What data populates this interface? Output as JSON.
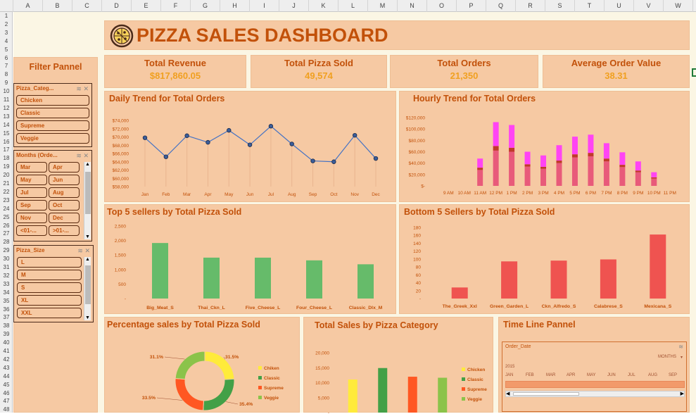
{
  "spreadsheet": {
    "columns": [
      "A",
      "B",
      "C",
      "D",
      "E",
      "F",
      "G",
      "H",
      "I",
      "J",
      "K",
      "L",
      "M",
      "N",
      "O",
      "P",
      "Q",
      "R",
      "S",
      "T",
      "U",
      "V",
      "W"
    ],
    "rows": [
      "1",
      "2",
      "3",
      "4",
      "5",
      "6",
      "7",
      "8",
      "9",
      "10",
      "11",
      "12",
      "13",
      "14",
      "15",
      "16",
      "17",
      "18",
      "19",
      "20",
      "21",
      "22",
      "23",
      "24",
      "25",
      "26",
      "27",
      "28",
      "29",
      "30",
      "31",
      "32",
      "33",
      "34",
      "35",
      "36",
      "37",
      "38",
      "39",
      "40",
      "41",
      "42",
      "43",
      "44",
      "45",
      "46",
      "47",
      "48"
    ]
  },
  "dashboard": {
    "title": "PIZZA SALES DASHBOARD"
  },
  "kpis": [
    {
      "label": "Total Revenue",
      "value": "$817,860.05"
    },
    {
      "label": "Total Pizza Sold",
      "value": "49,574"
    },
    {
      "label": "Total Orders",
      "value": "21,350"
    },
    {
      "label": "Average Order Value",
      "value": "38.31"
    }
  ],
  "filter_panel": {
    "title": "Filter Pannel",
    "category": {
      "header": "Pizza_Categ...",
      "items": [
        "Chicken",
        "Classic",
        "Supreme",
        "Veggie"
      ]
    },
    "months": {
      "header": "Months (Orde...",
      "items": [
        "Mar",
        "Apr",
        "May",
        "Jun",
        "Jul",
        "Aug",
        "Sep",
        "Oct",
        "Nov",
        "Dec",
        "<01-...",
        ">01-..."
      ]
    },
    "size": {
      "header": "Pizza_Size",
      "items": [
        "L",
        "M",
        "S",
        "XL",
        "XXL"
      ]
    }
  },
  "timeline": {
    "title": "Time Line Pannel",
    "field": "Order_Date",
    "level": "MONTHS",
    "year": "2015",
    "months": [
      "JAN",
      "FEB",
      "MAR",
      "APR",
      "MAY",
      "JUN",
      "JUL",
      "AUG",
      "SEP"
    ]
  },
  "colors": {
    "panel": "#f6c9a3",
    "title": "#c2510a",
    "kpi_value": "#f0a020",
    "line": "#4472c4",
    "green": "#66bb6a",
    "red": "#ef5350",
    "magenta": "#ff44f4",
    "pink": "#e85a7a"
  },
  "chart_data": [
    {
      "id": "daily",
      "type": "line",
      "title": "Daily Trend for Total Orders",
      "categories": [
        "Jan",
        "Feb",
        "Mar",
        "Apr",
        "May",
        "Jun",
        "Jul",
        "Aug",
        "Sep",
        "Oct",
        "Nov",
        "Dec"
      ],
      "values": [
        69800,
        65200,
        70300,
        68700,
        71600,
        68100,
        72600,
        68300,
        64200,
        64000,
        70400,
        64800
      ],
      "ylim": [
        58000,
        74000
      ],
      "yticks": [
        "$58,000",
        "$60,000",
        "$62,000",
        "$64,000",
        "$66,000",
        "$68,000",
        "$70,000",
        "$72,000",
        "$74,000"
      ]
    },
    {
      "id": "hourly",
      "type": "bar",
      "title": "Hourly Trend for Total Orders",
      "categories": [
        "9 AM",
        "10 AM",
        "11 AM",
        "12 PM",
        "1 PM",
        "2 PM",
        "3 PM",
        "4 PM",
        "5 PM",
        "6 PM",
        "7 PM",
        "8 PM",
        "9 PM",
        "10 PM",
        "11 PM"
      ],
      "series": [
        {
          "values": [
            0,
            0,
            28000,
            62000,
            60000,
            34000,
            30000,
            40000,
            50000,
            52000,
            43000,
            33000,
            24000,
            13000,
            0
          ]
        },
        {
          "values": [
            0,
            0,
            4000,
            8000,
            7000,
            4000,
            3500,
            4500,
            5500,
            6000,
            5000,
            4000,
            3000,
            2000,
            0
          ]
        },
        {
          "values": [
            0,
            0,
            16000,
            42000,
            40000,
            22000,
            20000,
            27000,
            31000,
            32000,
            27000,
            22000,
            16000,
            9000,
            0
          ]
        }
      ],
      "ylim": [
        0,
        120000
      ],
      "yticks": [
        "$-",
        "$20,000",
        "$40,000",
        "$60,000",
        "$80,000",
        "$100,000",
        "$120,000"
      ]
    },
    {
      "id": "top5",
      "type": "bar",
      "title": "Top 5 sellers by Total Pizza Sold",
      "categories": [
        "Big_Meat_S",
        "Thai_Ckn_L",
        "Five_Cheese_L",
        "Four_Cheese_L",
        "Classic_Dlx_M"
      ],
      "values": [
        1914,
        1410,
        1409,
        1316,
        1181
      ],
      "ylim": [
        0,
        2500
      ],
      "yticks": [
        "-",
        "500",
        "1,000",
        "1,500",
        "2,000",
        "2,500"
      ]
    },
    {
      "id": "bottom5",
      "type": "bar",
      "title": "Bottom 5 Sellers by Total Pizza Sold",
      "categories": [
        "The_Greek_Xxl",
        "Green_Garden_L",
        "Ckn_Alfredo_S",
        "Calabrese_S",
        "Mexicana_S"
      ],
      "values": [
        28,
        94,
        96,
        99,
        162
      ],
      "ylim": [
        0,
        180
      ],
      "yticks": [
        "-",
        "20",
        "40",
        "60",
        "80",
        "100",
        "120",
        "140",
        "160",
        "180"
      ]
    },
    {
      "id": "pct",
      "type": "pie",
      "title": "Percentage sales by Total Pizza Sold",
      "categories": [
        "Chiken",
        "Classic",
        "Supreme",
        "Veggie"
      ],
      "values": [
        31.5,
        35.4,
        33.5,
        31.1
      ],
      "labels": [
        "31.5%",
        "35.4%",
        "33.5%",
        "31.1%"
      ],
      "colors": [
        "#ffeb3b",
        "#43a047",
        "#ff5722",
        "#8bc34a"
      ]
    },
    {
      "id": "cat",
      "type": "bar",
      "title": "Total Sales by Pizza Category",
      "categories": [
        "Chicken",
        "Classic",
        "Supreme",
        "Veggie"
      ],
      "values": [
        11050,
        14888,
        11987,
        11649
      ],
      "ylim": [
        0,
        20000
      ],
      "yticks": [
        "-",
        "5,000",
        "10,000",
        "15,000",
        "20,000"
      ],
      "colors": [
        "#ffeb3b",
        "#43a047",
        "#ff5722",
        "#8bc34a"
      ]
    }
  ]
}
